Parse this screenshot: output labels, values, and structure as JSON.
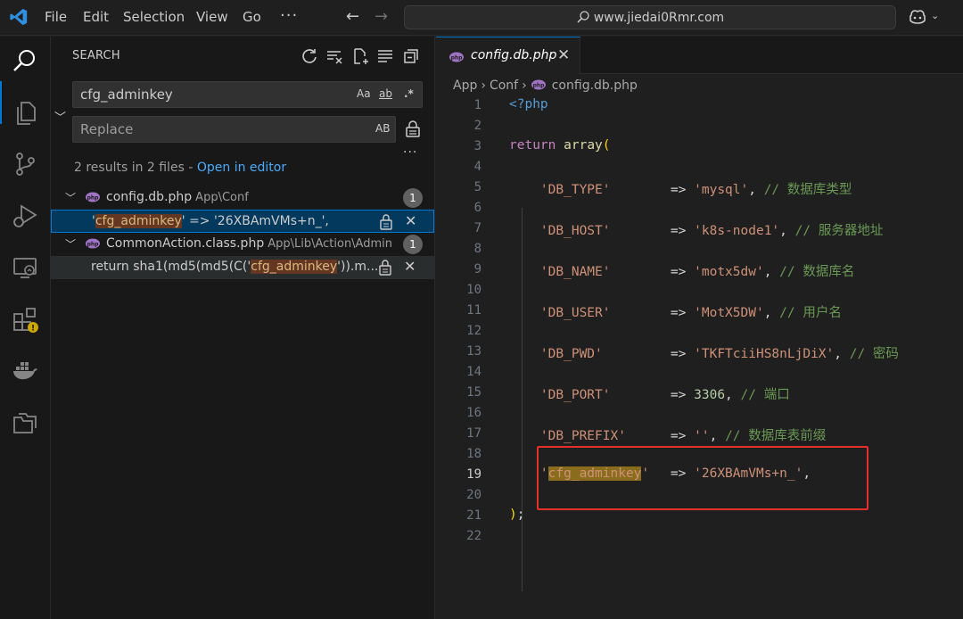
{
  "titlebar": {
    "menus": [
      "File",
      "Edit",
      "Selection",
      "View",
      "Go"
    ],
    "more": "···",
    "command_center": "www.jiedai0Rmr.com"
  },
  "activity_bar": {
    "items": [
      "search-icon",
      "explorer-icon",
      "source-control-icon",
      "run-debug-icon",
      "remote-explorer-icon",
      "extensions-icon",
      "docker-icon",
      "folders-icon"
    ],
    "active": "search-icon",
    "extensions_warning": true
  },
  "search": {
    "title": "SEARCH",
    "query": "cfg_adminkey",
    "replace_placeholder": "Replace",
    "options": {
      "match_case": "Aa",
      "whole_word": "ab",
      "regex": ".*",
      "preserve_case": "AB"
    },
    "more": "···",
    "summary": "2 results in 2 files - ",
    "open_in_editor": "Open in editor",
    "results": [
      {
        "file": "config.db.php",
        "path": "App\\Conf",
        "count": "1",
        "match": {
          "pre": "'",
          "hit": "cfg_adminkey",
          "post": "'  => '26XBAmVMs+n_',"
        }
      },
      {
        "file": "CommonAction.class.php",
        "path": "App\\Lib\\Action\\Admin",
        "count": "1",
        "match": {
          "pre": "return sha1(md5(md5(C('",
          "hit": "cfg_adminkey",
          "post": "')).m..."
        }
      }
    ]
  },
  "editor": {
    "tab": "config.db.php",
    "breadcrumb": [
      "App",
      "Conf",
      "config.db.php"
    ],
    "current_line": 19,
    "lines": [
      {
        "n": "1"
      },
      {
        "n": "2"
      },
      {
        "n": "3"
      },
      {
        "n": "4"
      },
      {
        "n": "5"
      },
      {
        "n": "6"
      },
      {
        "n": "7"
      },
      {
        "n": "8"
      },
      {
        "n": "9"
      },
      {
        "n": "10"
      },
      {
        "n": "11"
      },
      {
        "n": "12"
      },
      {
        "n": "13"
      },
      {
        "n": "14"
      },
      {
        "n": "15"
      },
      {
        "n": "16"
      },
      {
        "n": "17"
      },
      {
        "n": "18"
      },
      {
        "n": "19"
      },
      {
        "n": "20"
      },
      {
        "n": "21"
      },
      {
        "n": "22"
      }
    ],
    "code": {
      "l1": "<?php",
      "l3_kw": "return",
      "l3_fn": "array",
      "l3_par": "(",
      "entries": [
        {
          "key": "'DB_TYPE'",
          "val": "'mysql'",
          "comment": "// 数据库类型"
        },
        {
          "key": "'DB_HOST'",
          "val": "'k8s-node1'",
          "comment": "// 服务器地址"
        },
        {
          "key": "'DB_NAME'",
          "val": "'motx5dw'",
          "comment": "// 数据库名"
        },
        {
          "key": "'DB_USER'",
          "val": "'MotX5DW'",
          "comment": "// 用户名"
        },
        {
          "key": "'DB_PWD'",
          "val": "'TKFTciiHS8nLjDiX'",
          "comment": "// 密码"
        },
        {
          "key": "'DB_PORT'",
          "val": "3306",
          "comment": "// 端口"
        },
        {
          "key": "'DB_PREFIX'",
          "val": "''",
          "comment": "// 数据库表前缀"
        }
      ],
      "l19_q1": "'",
      "l19_key": "cfg_adminkey",
      "l19_q2": "'",
      "l19_val": "'26XBAmVMs+n_'",
      "arrow": "=>",
      "comma": ",",
      "l21": ")",
      "l21_semi": ";"
    }
  },
  "colors": {
    "accent": "#0078d4",
    "highlight_box": "#e5302a",
    "match_bg": "#653723"
  }
}
